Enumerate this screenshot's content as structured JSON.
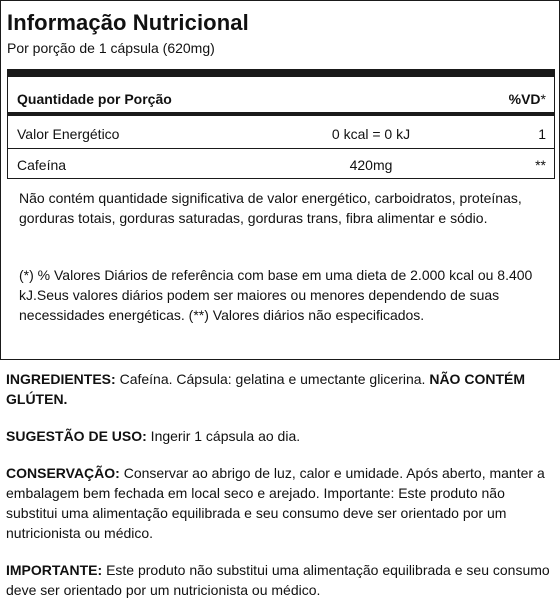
{
  "panel": {
    "title": "Informação Nutricional",
    "serving": "Por porção de 1 cápsula (620mg)"
  },
  "table": {
    "header": {
      "name": "Quantidade por Porção",
      "vd": "%VD",
      "vd_mark": "*"
    },
    "rows": [
      {
        "name": "Valor Energético",
        "qty": "0 kcal = 0 kJ",
        "vd": "1"
      },
      {
        "name": "Cafeína",
        "qty": "420mg",
        "vd": "**"
      }
    ]
  },
  "notes": {
    "insignificant": "Não contém quantidade significativa de valor energético, carboidratos, proteínas, gorduras totais, gorduras saturadas, gorduras trans, fibra alimentar e sódio.",
    "daily_values": "(*) % Valores Diários de referência com base em uma dieta de 2.000 kcal ou 8.400 kJ.Seus valores diários podem ser maiores ou menores dependendo de suas necessidades energéticas. (**) Valores diários não especificados."
  },
  "info": {
    "ingredients_label": "INGREDIENTES:",
    "ingredients_text": " Cafeína. Cápsula: gelatina e umectante glicerina. ",
    "ingredients_warning": "NÃO CONTÉM GLÚTEN.",
    "usage_label": "SUGESTÃO DE USO:",
    "usage_text": " Ingerir 1 cápsula ao dia.",
    "storage_label": "CONSERVAÇÃO:",
    "storage_text": " Conservar ao abrigo de luz, calor e umidade. Após aberto, manter a embalagem bem fechada em local seco e arejado. Importante: Este produto não substitui uma alimentação equilibrada e seu consumo deve ser orientado por um nutricionista ou médico.",
    "important_label": "IMPORTANTE:",
    "important_text": " Este produto não substitui uma alimentação equilibrada e seu consumo deve ser orientado por um nutricionista ou médico."
  }
}
